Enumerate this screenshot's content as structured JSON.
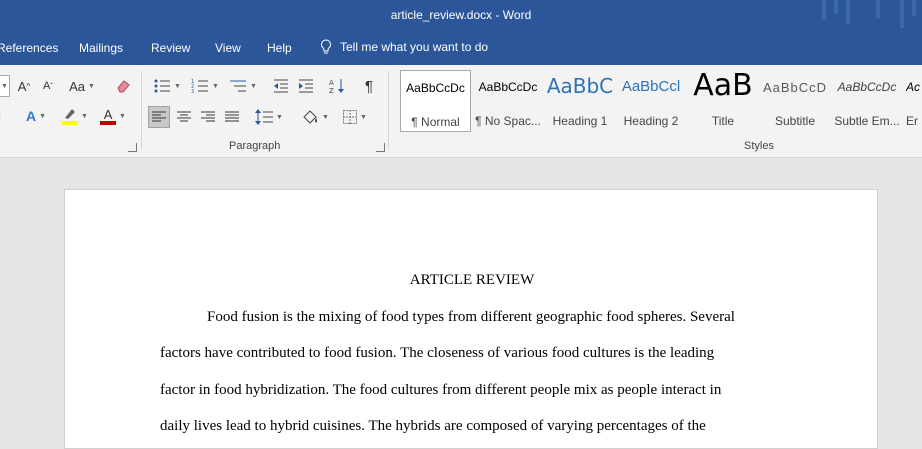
{
  "window": {
    "title": "article_review.docx  -  Word"
  },
  "tabs": {
    "references": "References",
    "mailings": "Mailings",
    "review": "Review",
    "view": "View",
    "help": "Help"
  },
  "tell_me": "Tell me what you want to do",
  "ribbon": {
    "font": {
      "grow": "A",
      "shrink": "A",
      "case": "Aa",
      "text_effects": "A",
      "font_color": "A"
    },
    "paragraph_label": "Paragraph",
    "styles_label": "Styles",
    "pilcrow": "¶"
  },
  "styles": [
    {
      "preview": "AaBbCcDc",
      "name": "¶ Normal"
    },
    {
      "preview": "AaBbCcDc",
      "name": "¶ No Spac..."
    },
    {
      "preview": "AaBbC",
      "name": "Heading 1"
    },
    {
      "preview": "AaBbCcl",
      "name": "Heading 2"
    },
    {
      "preview": "AaB",
      "name": "Title"
    },
    {
      "preview": "AaBbCcD",
      "name": "Subtitle"
    },
    {
      "preview": "AaBbCcDc",
      "name": "Subtle Em..."
    },
    {
      "preview": "Ac",
      "name": "Er"
    }
  ],
  "document": {
    "title": "ARTICLE REVIEW",
    "lines": [
      "Food fusion is the mixing of food types from different geographic food spheres. Several",
      "factors have contributed to food fusion. The closeness of various food cultures is the leading",
      "factor in food hybridization. The food cultures from different people mix as people interact in",
      "daily lives lead to hybrid cuisines. The hybrids are composed of varying percentages of the"
    ]
  },
  "colors": {
    "accent": "#2b579a",
    "highlight": "#ffff00",
    "font_color": "#c00000"
  }
}
